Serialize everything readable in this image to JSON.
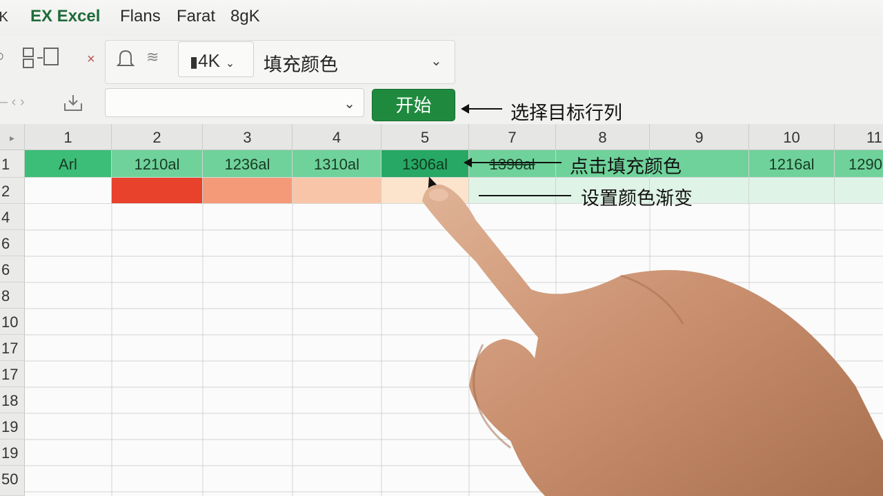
{
  "menu": {
    "cut_left": "lK",
    "brand": "EX Excel",
    "items": [
      "Flans",
      "Farat",
      "8gK"
    ]
  },
  "ribbon": {
    "size_value": "4K",
    "fill_label": "填充颜色",
    "start_button": "开始"
  },
  "grid": {
    "col_headers": [
      "1",
      "2",
      "3",
      "4",
      "5",
      "7",
      "8",
      "9",
      "10",
      "11"
    ],
    "row_headers": [
      "1",
      "2",
      "4",
      "6",
      "6",
      "8",
      "10",
      "17",
      "17",
      "18",
      "19",
      "19",
      "50"
    ],
    "row1_values": [
      "Arl",
      "1210al",
      "1236al",
      "1310al",
      "1306al",
      "1390al",
      "",
      "",
      "1216al",
      "1290"
    ]
  },
  "callouts": {
    "select_target": "选择目标行列",
    "click_fill": "点击填充颜色",
    "set_gradient": "设置颜色渐变"
  },
  "colors": {
    "accent": "#1f8a3e",
    "header_green": "#3dbd7a",
    "gradient": [
      "#e8412c",
      "#f59a78",
      "#f8c5a8",
      "#fbe3cc"
    ]
  }
}
